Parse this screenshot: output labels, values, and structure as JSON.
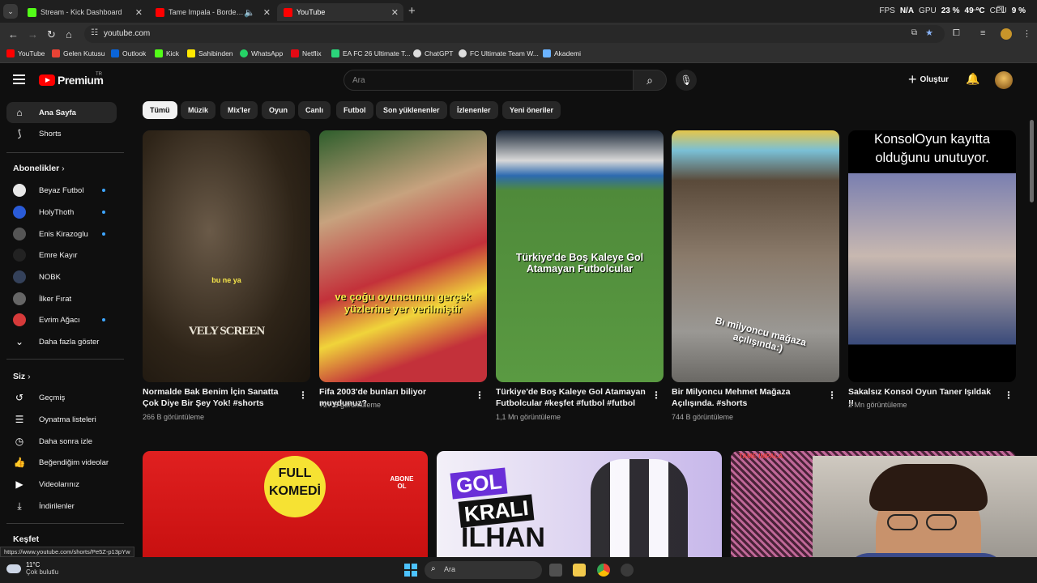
{
  "browser": {
    "tabs": [
      {
        "title": "Stream - Kick Dashboard",
        "icon": "kick-icon",
        "color": "#53fc18"
      },
      {
        "title": "Tame Impala - Borderline (C",
        "icon": "youtube-icon",
        "color": "#ff0000",
        "audio": "🔈"
      },
      {
        "title": "YouTube",
        "icon": "youtube-icon",
        "color": "#ff0000"
      }
    ],
    "new_tab": "+",
    "perf": {
      "fps_label": "FPS",
      "fps": "N/A",
      "gpu_label": "GPU",
      "gpu": "23 %",
      "gpu_temp": "49 °C",
      "cpu_label": "CPU",
      "cpu": "9 %"
    },
    "url": "youtube.com",
    "bookmarks": [
      {
        "label": "YouTube",
        "color": "#ff0000"
      },
      {
        "label": "Gelen Kutusu",
        "color": "#ea4335"
      },
      {
        "label": "Outlook",
        "color": "#0a64d8"
      },
      {
        "label": "Kick",
        "color": "#53fc18"
      },
      {
        "label": "Sahibinden",
        "color": "#ffe800"
      },
      {
        "label": "WhatsApp",
        "color": "#25d366"
      },
      {
        "label": "Netflix",
        "color": "#e50914"
      },
      {
        "label": "EA FC 26 Ultimate T...",
        "color": "#2bd67b"
      },
      {
        "label": "ChatGPT",
        "color": "#dddddd"
      },
      {
        "label": "FC Ultimate Team W...",
        "color": "#dddddd"
      },
      {
        "label": "Akademi",
        "color": "#6bb3ff"
      }
    ]
  },
  "youtube": {
    "logo_text": "Premium",
    "logo_sup": "TR",
    "search_placeholder": "Ara",
    "create_label": "Oluştur",
    "chips": [
      "Tümü",
      "Müzik",
      "Mix'ler",
      "Oyun",
      "Canlı",
      "Futbol",
      "Son yüklenenler",
      "İzlenenler",
      "Yeni öneriler"
    ],
    "sidebar": {
      "main": [
        {
          "label": "Ana Sayfa",
          "icon": "home-icon",
          "glyph": "⌂"
        },
        {
          "label": "Shorts",
          "icon": "shorts-icon",
          "glyph": "⟆"
        }
      ],
      "subs_title": "Abonelikler",
      "subs": [
        {
          "label": "Beyaz Futbol",
          "color": "#e8e8e8",
          "dot": true
        },
        {
          "label": "HolyThoth",
          "color": "#2a5bd7",
          "dot": true
        },
        {
          "label": "Enis Kirazoglu",
          "color": "#555555",
          "dot": true
        },
        {
          "label": "Emre Kayır",
          "color": "#222222",
          "dot": false
        },
        {
          "label": "NOBK",
          "color": "#34415a",
          "dot": false
        },
        {
          "label": "İlker Fırat",
          "color": "#666666",
          "dot": false
        },
        {
          "label": "Evrim Ağacı",
          "color": "#d63a3a",
          "dot": true
        }
      ],
      "more": "Daha fazla göster",
      "you_title": "Siz",
      "you": [
        {
          "label": "Geçmiş",
          "icon": "history-icon",
          "glyph": "↺"
        },
        {
          "label": "Oynatma listeleri",
          "icon": "playlist-icon",
          "glyph": "☰"
        },
        {
          "label": "Daha sonra izle",
          "icon": "clock-icon",
          "glyph": "◷"
        },
        {
          "label": "Beğendiğim videolar",
          "icon": "thumbs-up-icon",
          "glyph": "👍"
        },
        {
          "label": "Videolarınız",
          "icon": "video-icon",
          "glyph": "▶"
        },
        {
          "label": "İndirilenler",
          "icon": "download-icon",
          "glyph": "⤓"
        }
      ],
      "explore_title": "Keşfet"
    },
    "shorts": [
      {
        "title": "Normalde Bak Benim İçin Sanatta Çok Diye Bir Şey Yok! #shorts",
        "views": "266 B görüntüleme",
        "overlay": "bu ne ya",
        "overlay2": "VELY SCREEN"
      },
      {
        "title": "Fifa 2003'de bunları biliyor muydunuz?",
        "views": "727 B görüntüleme",
        "overlay": "ve çoğu oyuncunun gerçek yüzlerine yer verilmiştir"
      },
      {
        "title": "Türkiye'de Boş Kaleye Gol Atamayan Futbolcular #keşfet #futbol #futbol",
        "views": "1,1 Mn görüntüleme",
        "overlay": "Türkiye'de Boş Kaleye Gol Atamayan Futbolcular"
      },
      {
        "title": "Bir Milyoncu Mehmet Mağaza Açılışında. #shorts",
        "views": "744 B görüntüleme",
        "overlay": "Bı milyoncu mağaza açılışında:)"
      },
      {
        "title": "Sakalsız Konsol Oyun Taner Işıldak !!",
        "views": "2 Mn görüntüleme",
        "overlay": "KonsolOyun kayıtta olduğunu unutuyor."
      }
    ],
    "videos": [
      {
        "overlay_a": "FULL",
        "overlay_b": "KOMEDİ",
        "badge": "ABONE OL"
      },
      {
        "overlay_a": "GOL",
        "overlay_b": "KRALI",
        "overlay_c": "İLHAN"
      },
      {
        "overlay_a": "TAME IMPALA"
      }
    ],
    "status_url": "https://www.youtube.com/shorts/Pe5Z-p13pYw"
  },
  "taskbar": {
    "temp": "11°C",
    "weather": "Çok bulutlu",
    "search": "Ara"
  }
}
